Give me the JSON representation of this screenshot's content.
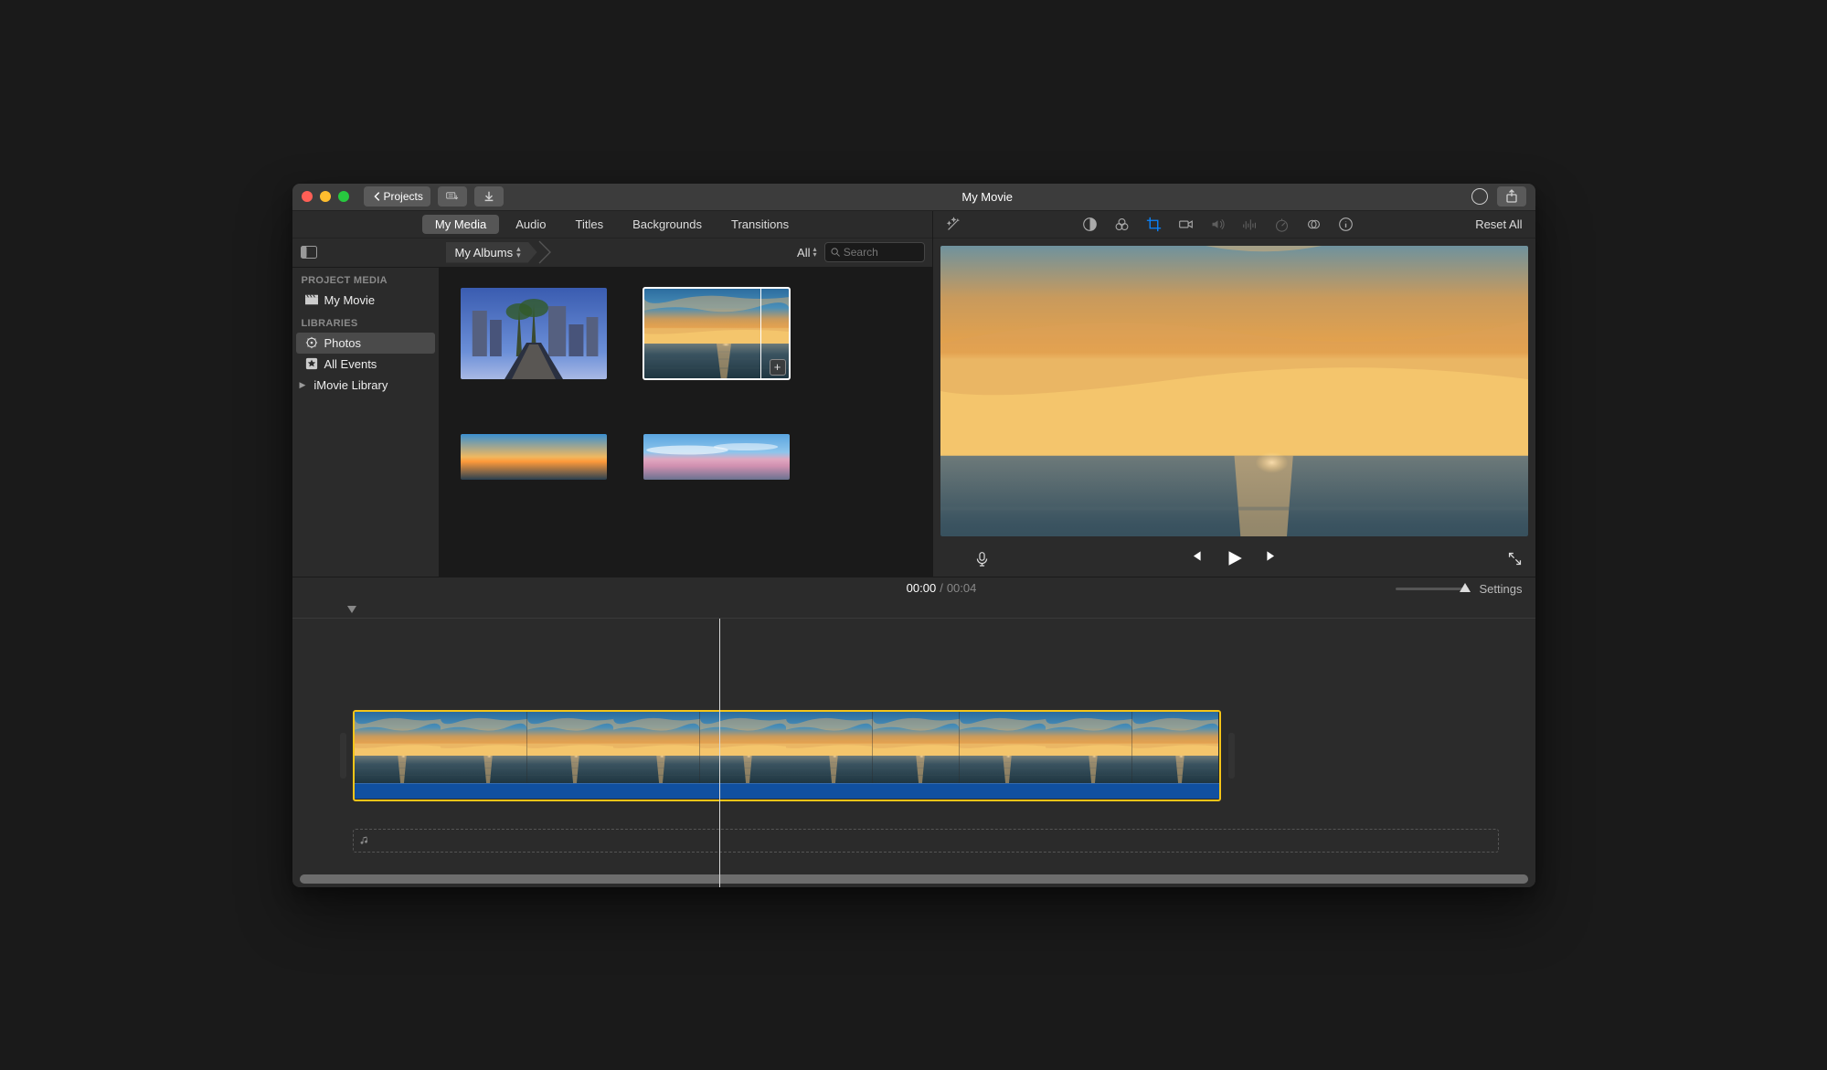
{
  "window": {
    "title": "My Movie",
    "back_label": "Projects"
  },
  "tabs": {
    "my_media": "My Media",
    "audio": "Audio",
    "titles": "Titles",
    "backgrounds": "Backgrounds",
    "transitions": "Transitions"
  },
  "sidebar": {
    "project_media_header": "PROJECT MEDIA",
    "project_name": "My Movie",
    "libraries_header": "LIBRARIES",
    "photos": "Photos",
    "all_events": "All Events",
    "imovie_library": "iMovie Library"
  },
  "browser": {
    "album_label": "My Albums",
    "filter_label": "All",
    "search_placeholder": "Search"
  },
  "viewer": {
    "reset_label": "Reset All"
  },
  "timeline": {
    "current": "00:00",
    "duration": "00:04",
    "settings_label": "Settings"
  }
}
